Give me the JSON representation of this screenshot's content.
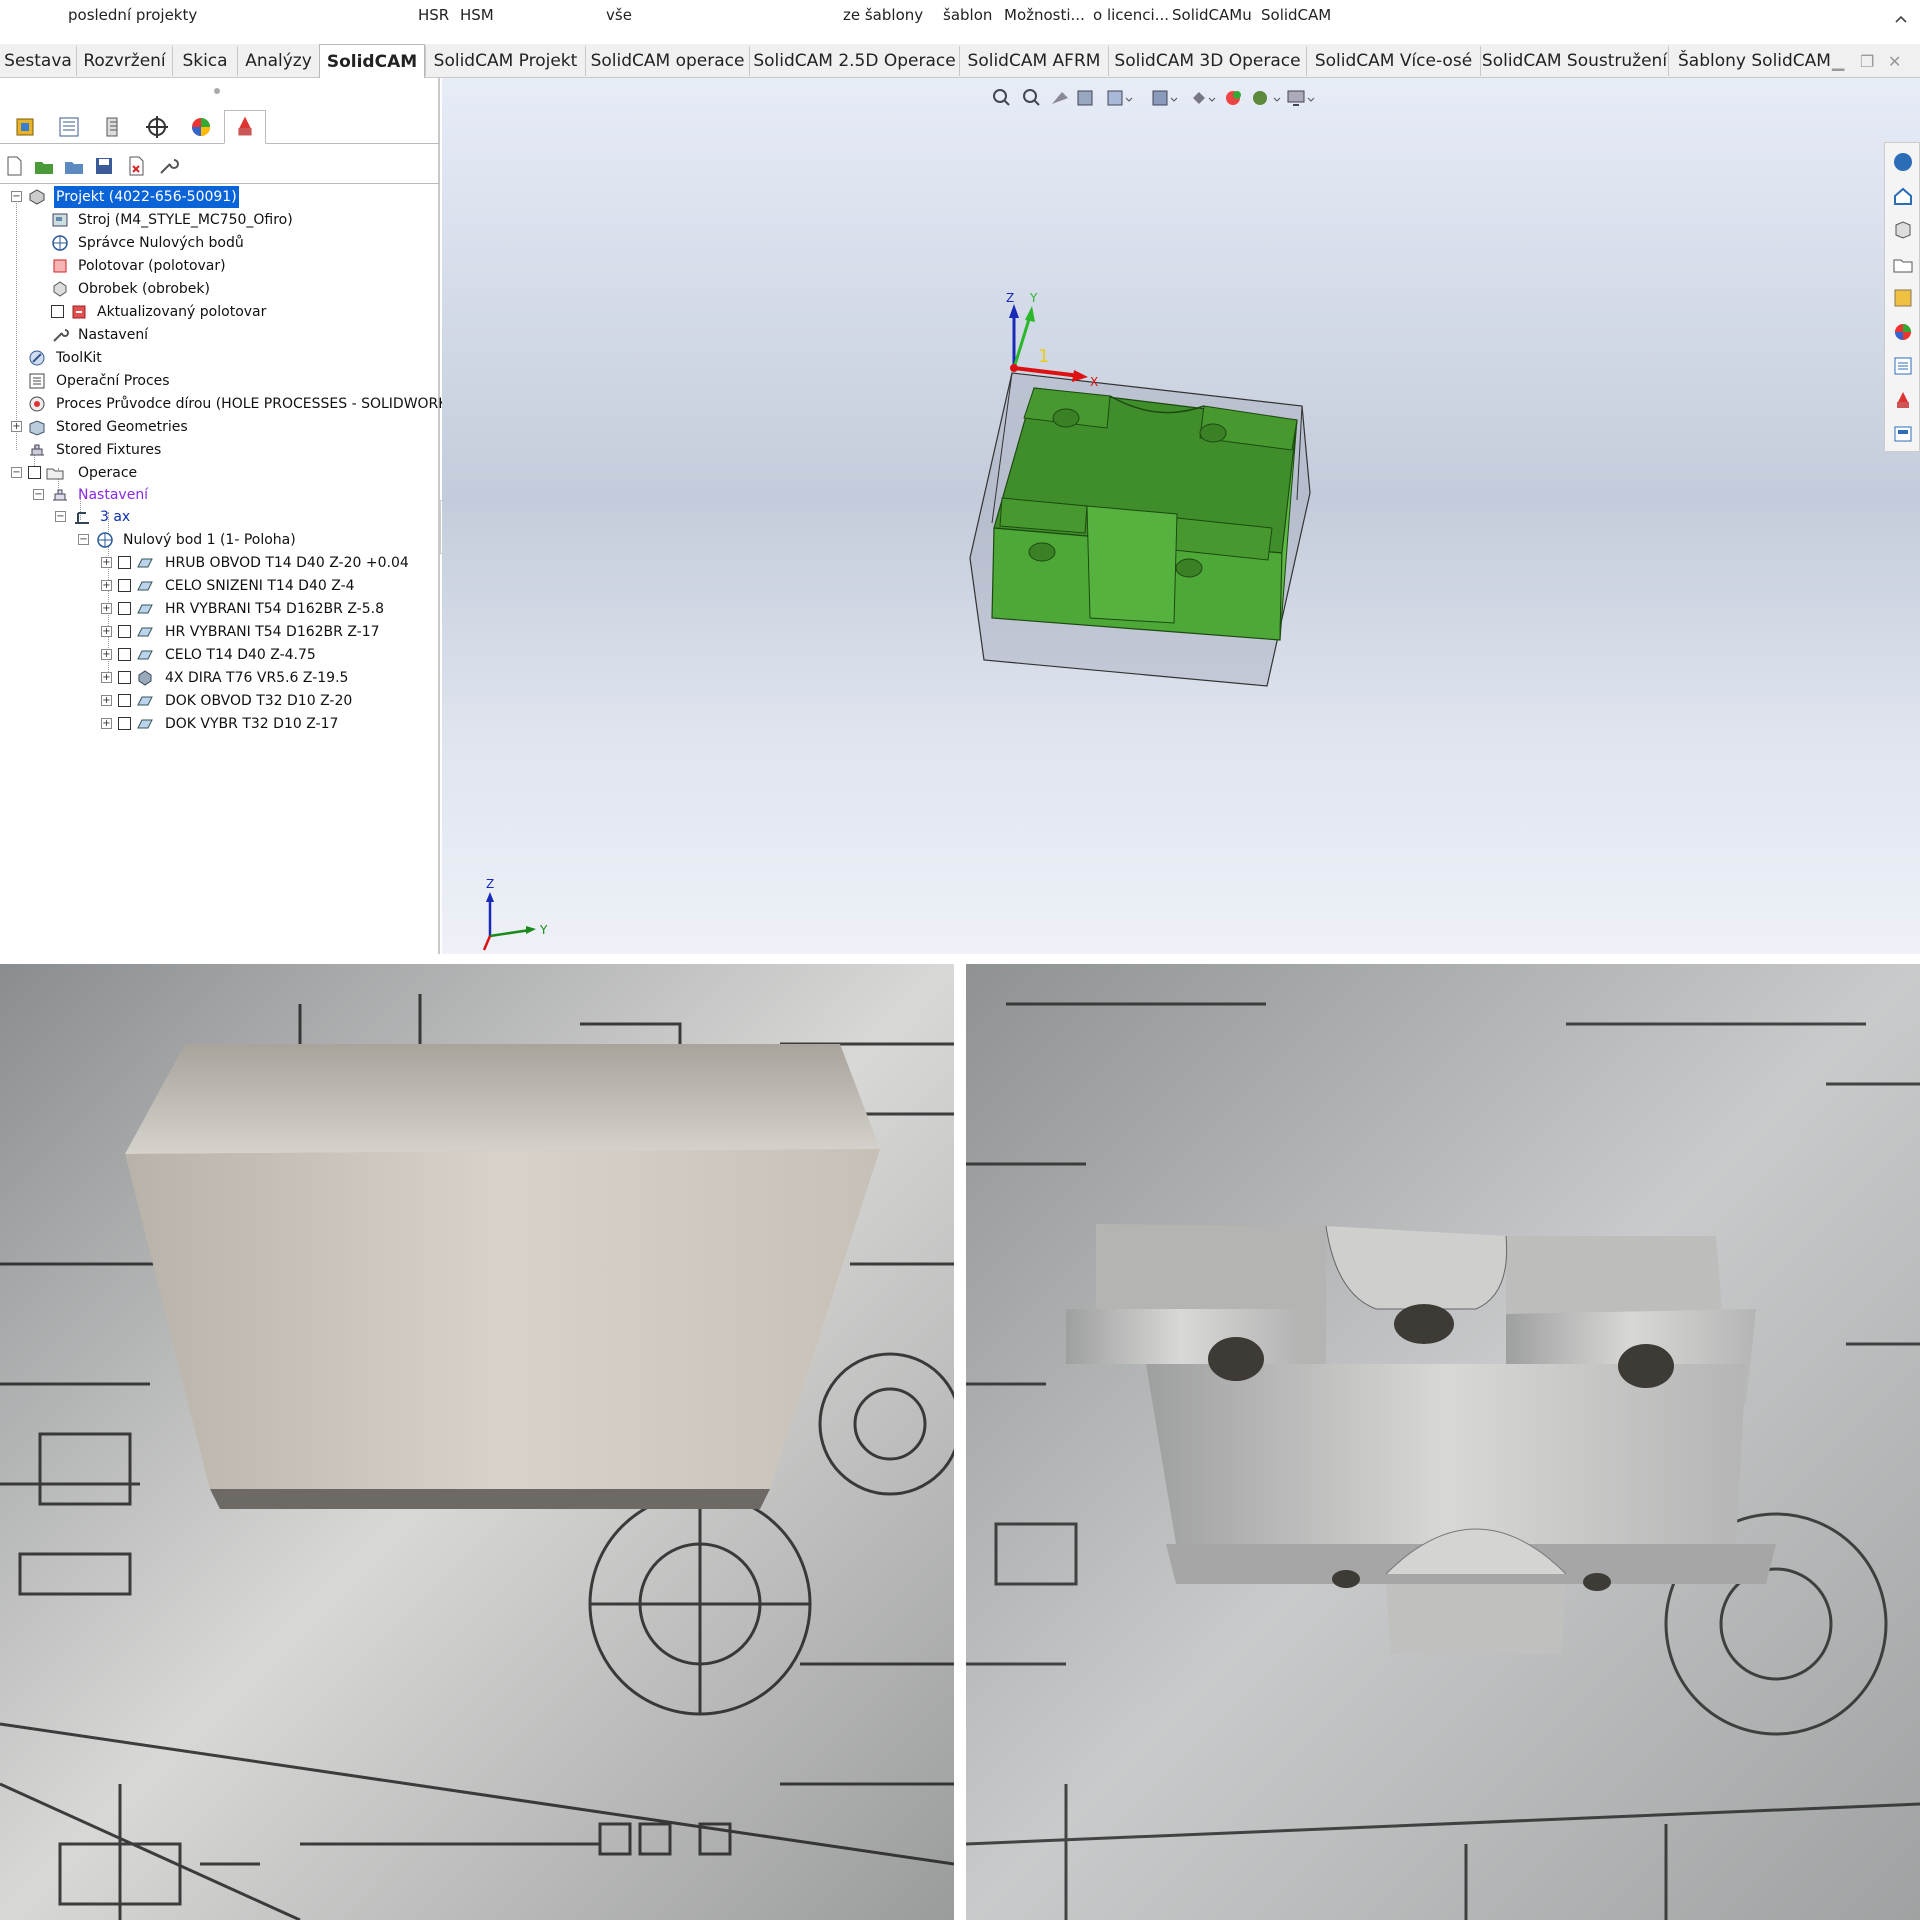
{
  "top_strip": [
    "poslední projekty",
    "HSR",
    "HSM",
    "vše",
    "ze šablony",
    "šablon",
    "Možnosti...",
    "o licenci...",
    "SolidCAMu",
    "SolidCAM"
  ],
  "tabs": [
    "Sestava",
    "Rozvržení",
    "Skica",
    "Analýzy",
    "SolidCAM",
    "SolidCAM Projekt",
    "SolidCAM operace",
    "SolidCAM 2.5D Operace",
    "SolidCAM AFRM",
    "SolidCAM 3D Operace",
    "SolidCAM Více-osé",
    "SolidCAM Soustružení",
    "Šablony SolidCAM"
  ],
  "active_tab": "SolidCAM",
  "tree": {
    "project": "Projekt (4022-656-50091)",
    "machine": "Stroj (M4_STYLE_MC750_Ofiro)",
    "zero_mgr": "Správce Nulových bodů",
    "stock": "Polotovar (polotovar)",
    "target": "Obrobek (obrobek)",
    "updated_stock": "Aktualizovaný polotovar",
    "settings": "Nastavení",
    "toolkit": "ToolKit",
    "process": "Operační Proces",
    "hole_process": "Proces Průvodce dírou (HOLE PROCESSES - SOLIDWORKS",
    "stored_geo": "Stored Geometries",
    "stored_fix": "Stored Fixtures",
    "operations": "Operace",
    "setup": "Nastavení",
    "axis": "3 ax",
    "zero_point": "Nulový bod 1 (1- Poloha)",
    "ops": [
      "HRUB OBVOD T14 D40 Z-20 +0.04",
      "CELO SNIZENI T14 D40 Z-4",
      "HR VYBRANI T54 D162BR Z-5.8",
      "HR VYBRANI T54 D162BR Z-17",
      "CELO T14 D40 Z-4.75",
      "4X DIRA T76 VR5.6 Z-19.5",
      "DOK OBVOD T32 D10 Z-20",
      "DOK VYBR T32 D10 Z-17"
    ]
  },
  "viewport": {
    "axis_z": "Z",
    "axis_y": "Y",
    "axis_x": "X",
    "origin_label": "1",
    "triad_z": "Z",
    "triad_y": "Y",
    "part_color": "#3e8a2a",
    "stock_color": "#8e95a8"
  }
}
